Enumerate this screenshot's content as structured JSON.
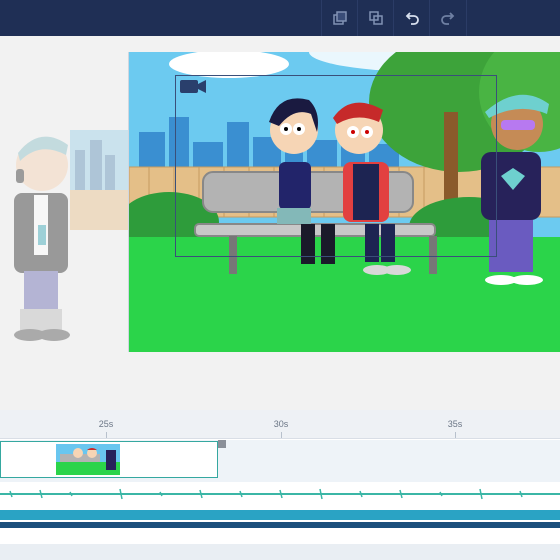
{
  "toolbar": {
    "buttons": [
      {
        "name": "copy-layer-icon"
      },
      {
        "name": "duplicate-icon"
      },
      {
        "name": "undo-icon"
      },
      {
        "name": "redo-icon"
      }
    ]
  },
  "timeline": {
    "ticks": [
      "25s",
      "30s",
      "35s"
    ]
  }
}
